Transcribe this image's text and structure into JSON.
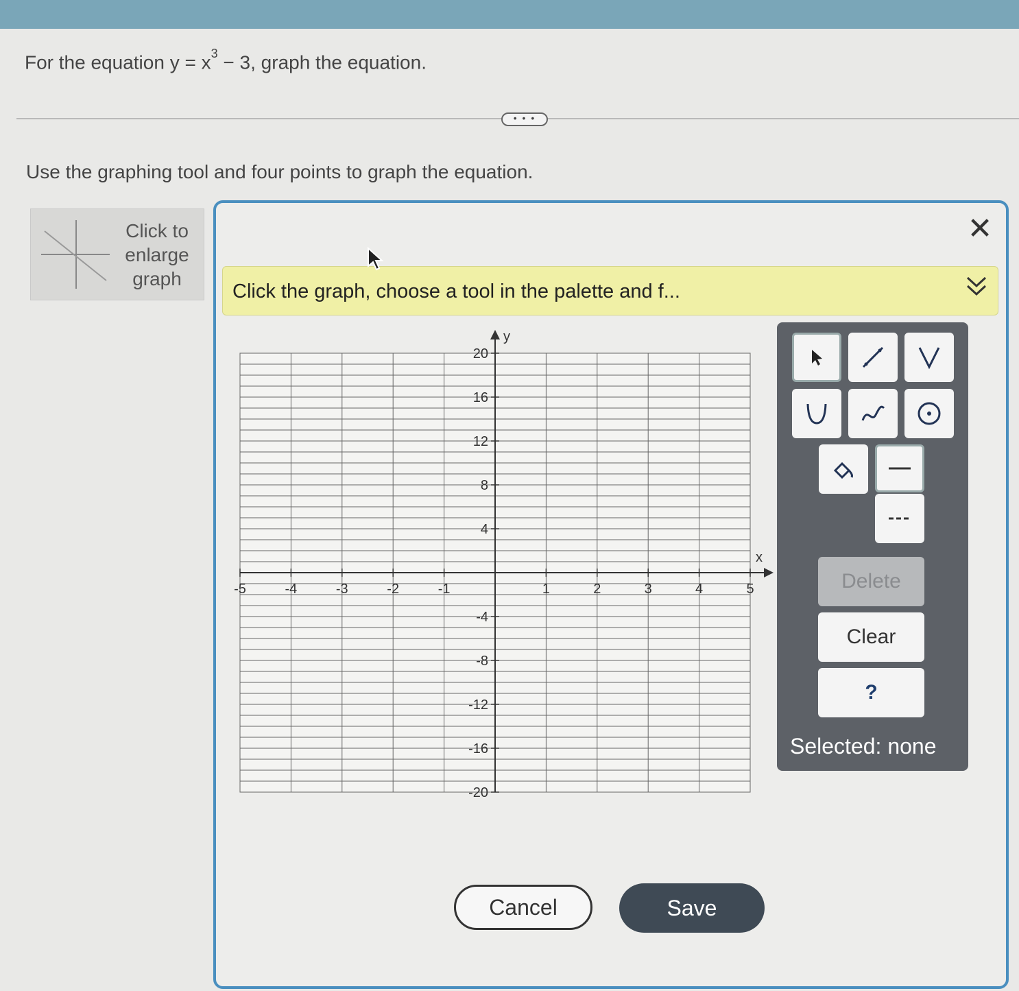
{
  "question": {
    "prefix": "For the equation y = x",
    "exponent": "3",
    "suffix": " − 3, graph the equation."
  },
  "more_button": "• • •",
  "instruction": "Use the graphing tool and four points to graph the equation.",
  "enlarge_label": "Click to enlarge graph",
  "dialog": {
    "close_symbol": "✕",
    "hint": "Click the graph, choose a tool in the palette and f...",
    "expand_symbol": "»"
  },
  "graph": {
    "x_axis_label": "x",
    "y_axis_label": "y",
    "x_range": [
      -5,
      5
    ],
    "y_range": [
      -20,
      20
    ],
    "x_ticks": [
      "-5",
      "-4",
      "-3",
      "-2",
      "-1",
      "1",
      "2",
      "3",
      "4",
      "5"
    ],
    "y_ticks": [
      "20",
      "16",
      "12",
      "8",
      "4",
      "-4",
      "-8",
      "-12",
      "-16",
      "-20"
    ],
    "grid_y_step": 1,
    "grid_x_step": 1
  },
  "palette": {
    "tools": [
      "pointer-icon",
      "line-segment-icon",
      "absolute-value-icon",
      "parabola-icon",
      "cubic-curve-icon",
      "circle-icon",
      "fill-icon",
      "solid-line-icon",
      "dashed-line-icon"
    ],
    "delete_label": "Delete",
    "clear_label": "Clear",
    "help_label": "?",
    "selected_status": "Selected: none"
  },
  "buttons": {
    "cancel": "Cancel",
    "save": "Save"
  },
  "colors": {
    "top_bar": "#7aa6b8",
    "dialog_border": "#4a8fbf",
    "hint_bg": "#f0f0a6",
    "palette_bg": "#5d6167",
    "save_bg": "#3f4a55"
  }
}
